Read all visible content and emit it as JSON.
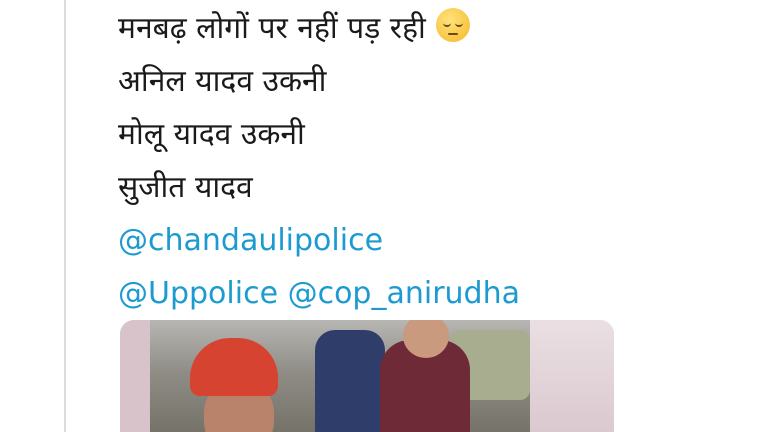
{
  "tweet": {
    "lines": [
      "मनबढ़ लोगों पर नहीं पड़ रही",
      "अनिल यादव उकनी",
      "मोलू यादव उकनी",
      "सुजीत यादव"
    ],
    "emoji": "pensive-face-emoji",
    "mentions": {
      "line1": "@chandaulipolice",
      "line2_a": "@Uppolice",
      "line2_b": "@cop_anirudha"
    },
    "mention_color": "#1d9bd1"
  },
  "media": {
    "type": "video-thumbnail"
  }
}
